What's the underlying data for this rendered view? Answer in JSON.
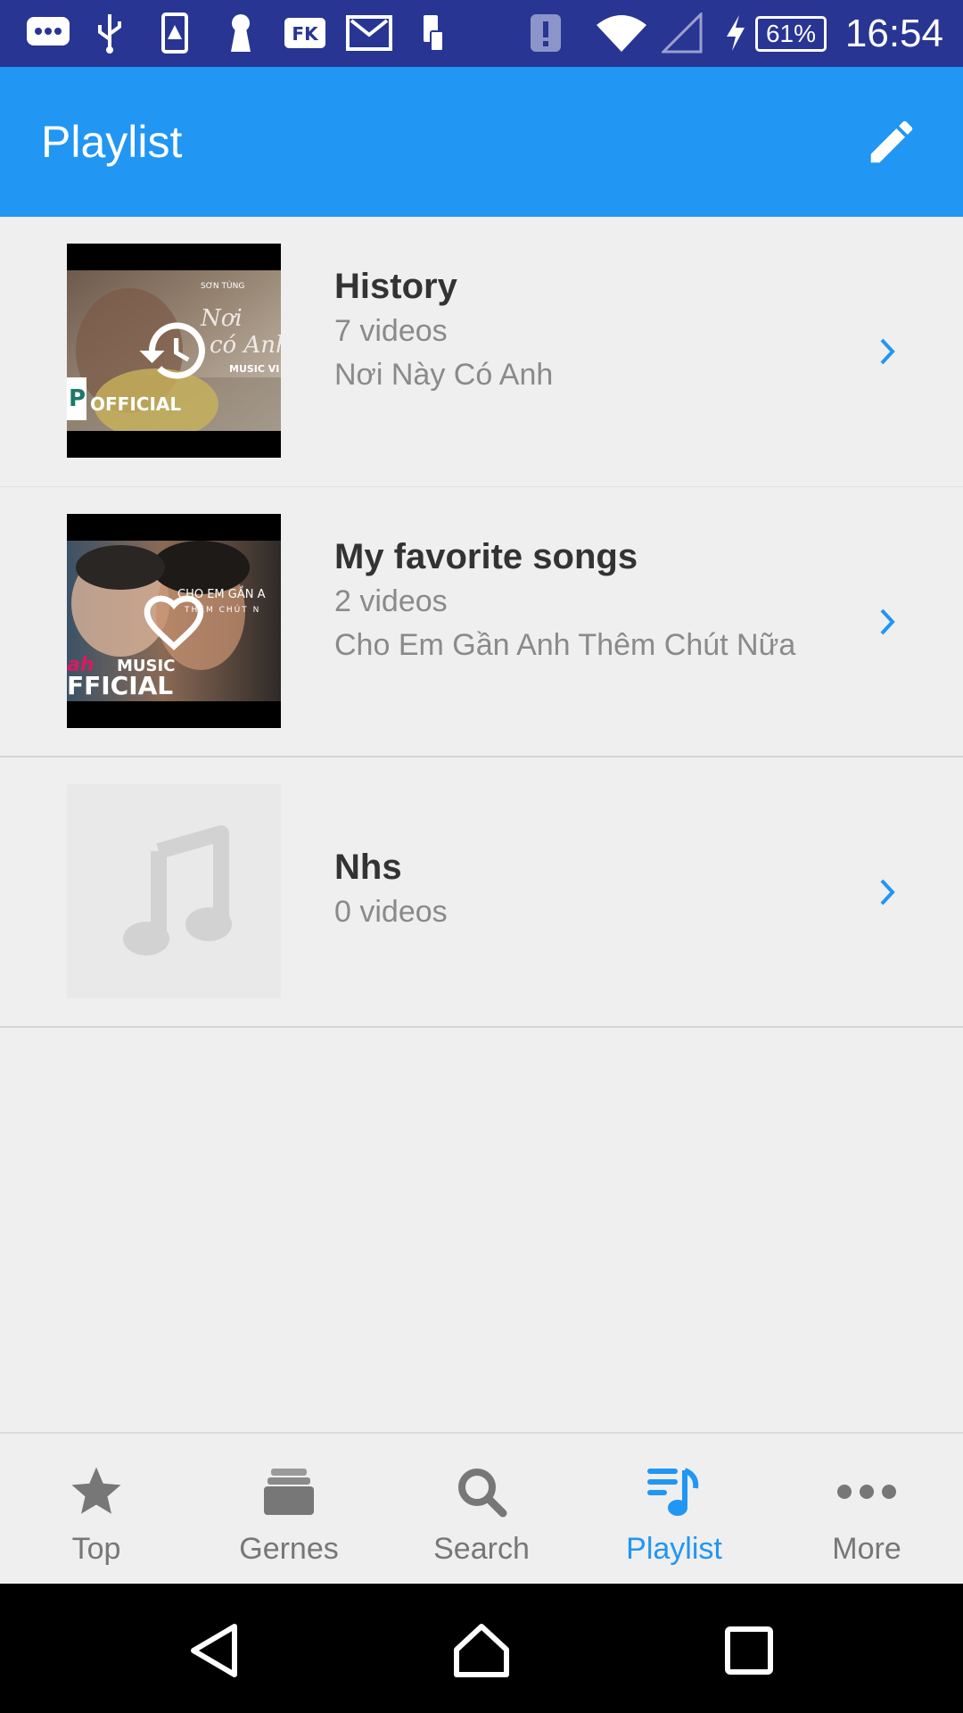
{
  "status_bar": {
    "time": "16:54",
    "battery": "61%",
    "icons": [
      "chat-icon",
      "usb-icon",
      "warning-icon",
      "keyhole-icon",
      "fk-icon",
      "gmail-icon",
      "phone-icon",
      "alert-icon",
      "wifi-icon",
      "signal-icon",
      "charging-icon"
    ]
  },
  "app_bar": {
    "title": "Playlist",
    "edit_icon": "pencil-icon"
  },
  "playlists": [
    {
      "title": "History",
      "count": "7 videos",
      "last": "Nơi Này Có Anh",
      "overlay_icon": "history-icon"
    },
    {
      "title": "My favorite songs",
      "count": "2 videos",
      "last": "Cho Em Gần Anh Thêm Chút Nữa",
      "overlay_icon": "heart-icon"
    },
    {
      "title": "Nhs",
      "count": "0 videos",
      "placeholder_icon": "music-note-icon"
    }
  ],
  "thumb_text": {
    "official": "OFFICIAL",
    "p": "P",
    "music_vi": "MUSIC VI",
    "co_anh": "Nơi Này Có Anh",
    "son_tung": "SƠN TÙNG",
    "cho_em": "CHO EM GẦN A",
    "them": "THÊM CHÚT N",
    "ah": "ah",
    "music": "MUSIC",
    "fficial": "FFICIAL"
  },
  "bottom_nav": [
    {
      "label": "Top",
      "icon": "star-icon"
    },
    {
      "label": "Gernes",
      "icon": "stack-icon"
    },
    {
      "label": "Search",
      "icon": "search-icon"
    },
    {
      "label": "Playlist",
      "icon": "playlist-icon",
      "active": true
    },
    {
      "label": "More",
      "icon": "more-icon"
    }
  ],
  "colors": {
    "status_bar": "#283593",
    "app_bar": "#2196f3",
    "accent": "#2196f3",
    "background": "#efefef"
  }
}
